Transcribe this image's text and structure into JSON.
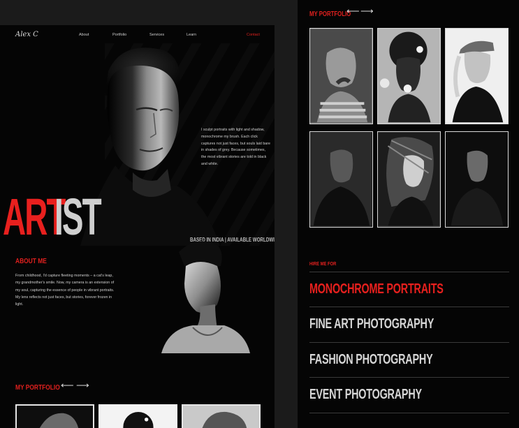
{
  "nav": {
    "logo": "Alex C",
    "links": [
      "About",
      "Portfolio",
      "Services",
      "Learn"
    ],
    "contact": "Contact"
  },
  "hero": {
    "title_red": "ART",
    "title_white": "IST",
    "intro": "I sculpt portraits with light and shadow, monochrome my brush. Each click captures not just faces, but souls laid bare in shades of grey. Because sometimes, the most vibrant stories are told in black and white.",
    "location": "BASED IN INDIA | AVAILABLE WORLDWIDE"
  },
  "about": {
    "heading": "ABOUT ME",
    "text": "From childhood, I'd capture fleeting moments – a cat's leap, my grandmother's smile. Now, my camera is an extension of my soul, capturing the essence of people in vibrant portraits. My lens reflects not just faces, but stories, forever frozen in light."
  },
  "portfolio": {
    "heading": "MY PORTFOLIO",
    "prev_icon": "arrow-left-icon",
    "next_icon": "arrow-right-icon",
    "prev_glyph": "⟵",
    "next_glyph": "⟶"
  },
  "hire": {
    "heading": "HIRE ME FOR",
    "services": [
      {
        "label": "MONOCHROME PORTRAITS",
        "active": true
      },
      {
        "label": "FINE ART PHOTOGRAPHY",
        "active": false
      },
      {
        "label": "FASHION PHOTOGRAPHY",
        "active": false
      },
      {
        "label": "EVENT PHOTOGRAPHY",
        "active": false
      }
    ]
  },
  "colors": {
    "accent": "#e8201e",
    "panel_bg": "#050505",
    "page_bg": "#1b1b1b",
    "text": "#cfcfcf"
  }
}
